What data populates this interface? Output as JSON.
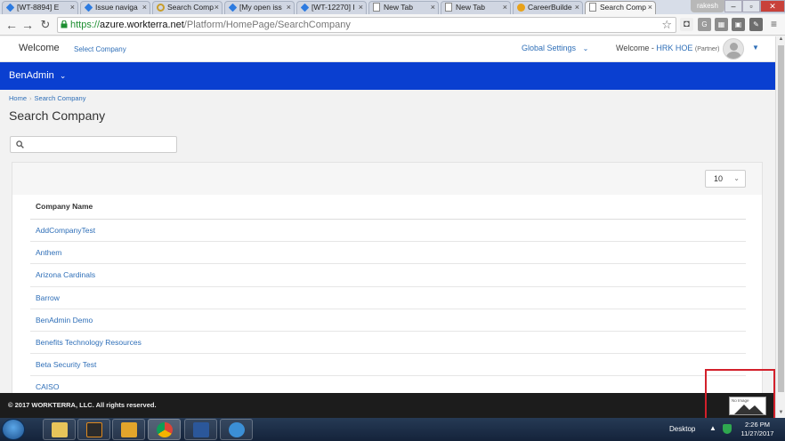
{
  "browser": {
    "tabs": [
      {
        "label": "[WT-8894] E",
        "icon": "jira-icon",
        "active": false
      },
      {
        "label": "Issue naviga",
        "icon": "jira-icon",
        "active": false
      },
      {
        "label": "Search Comp",
        "icon": "gear-favicon-icon",
        "active": false
      },
      {
        "label": "[My open iss",
        "icon": "jira-icon",
        "active": false
      },
      {
        "label": "[WT-12270] I",
        "icon": "jira-icon",
        "active": false
      },
      {
        "label": "New Tab",
        "icon": "blank-page-icon",
        "active": false
      },
      {
        "label": "New Tab",
        "icon": "blank-page-icon",
        "active": false
      },
      {
        "label": "CareerBuilde",
        "icon": "careerbuilder-icon",
        "active": false
      },
      {
        "label": "Search Comp",
        "icon": "blank-page-icon",
        "active": true
      }
    ],
    "tab_close_glyph": "×",
    "profile_name": "rakesh",
    "url_scheme": "https://",
    "url_host": "azure.workterra.net",
    "url_path": "/Platform/HomePage/SearchCompany"
  },
  "header": {
    "welcome": "Welcome",
    "select_company": "Select Company",
    "global_settings": "Global Settings",
    "welcome_prefix": "Welcome - ",
    "user_name": "HRK HOE",
    "user_role": "(Partner)"
  },
  "nav": {
    "menu_label": "BenAdmin"
  },
  "breadcrumb": {
    "home": "Home",
    "current": "Search Company"
  },
  "page": {
    "title": "Search Company",
    "search_value": "",
    "page_size": "10"
  },
  "table": {
    "column_header": "Company Name",
    "rows": [
      "AddCompanyTest",
      "Anthem",
      "Arizona Cardinals",
      "Barrow",
      "BenAdmin Demo",
      "Benefits Technology Resources",
      "Beta Security Test",
      "CAISO"
    ]
  },
  "footer": {
    "copyright": "© 2017 WORKTERRA, LLC. All rights reserved.",
    "no_image_label": "No Image"
  },
  "taskbar": {
    "desktop_label": "Desktop",
    "time": "2:26 PM",
    "date": "11/27/2017"
  },
  "colors": {
    "brand_blue": "#0a3fd0",
    "link_blue": "#2f6fb8",
    "highlight_red": "#d3202b"
  }
}
